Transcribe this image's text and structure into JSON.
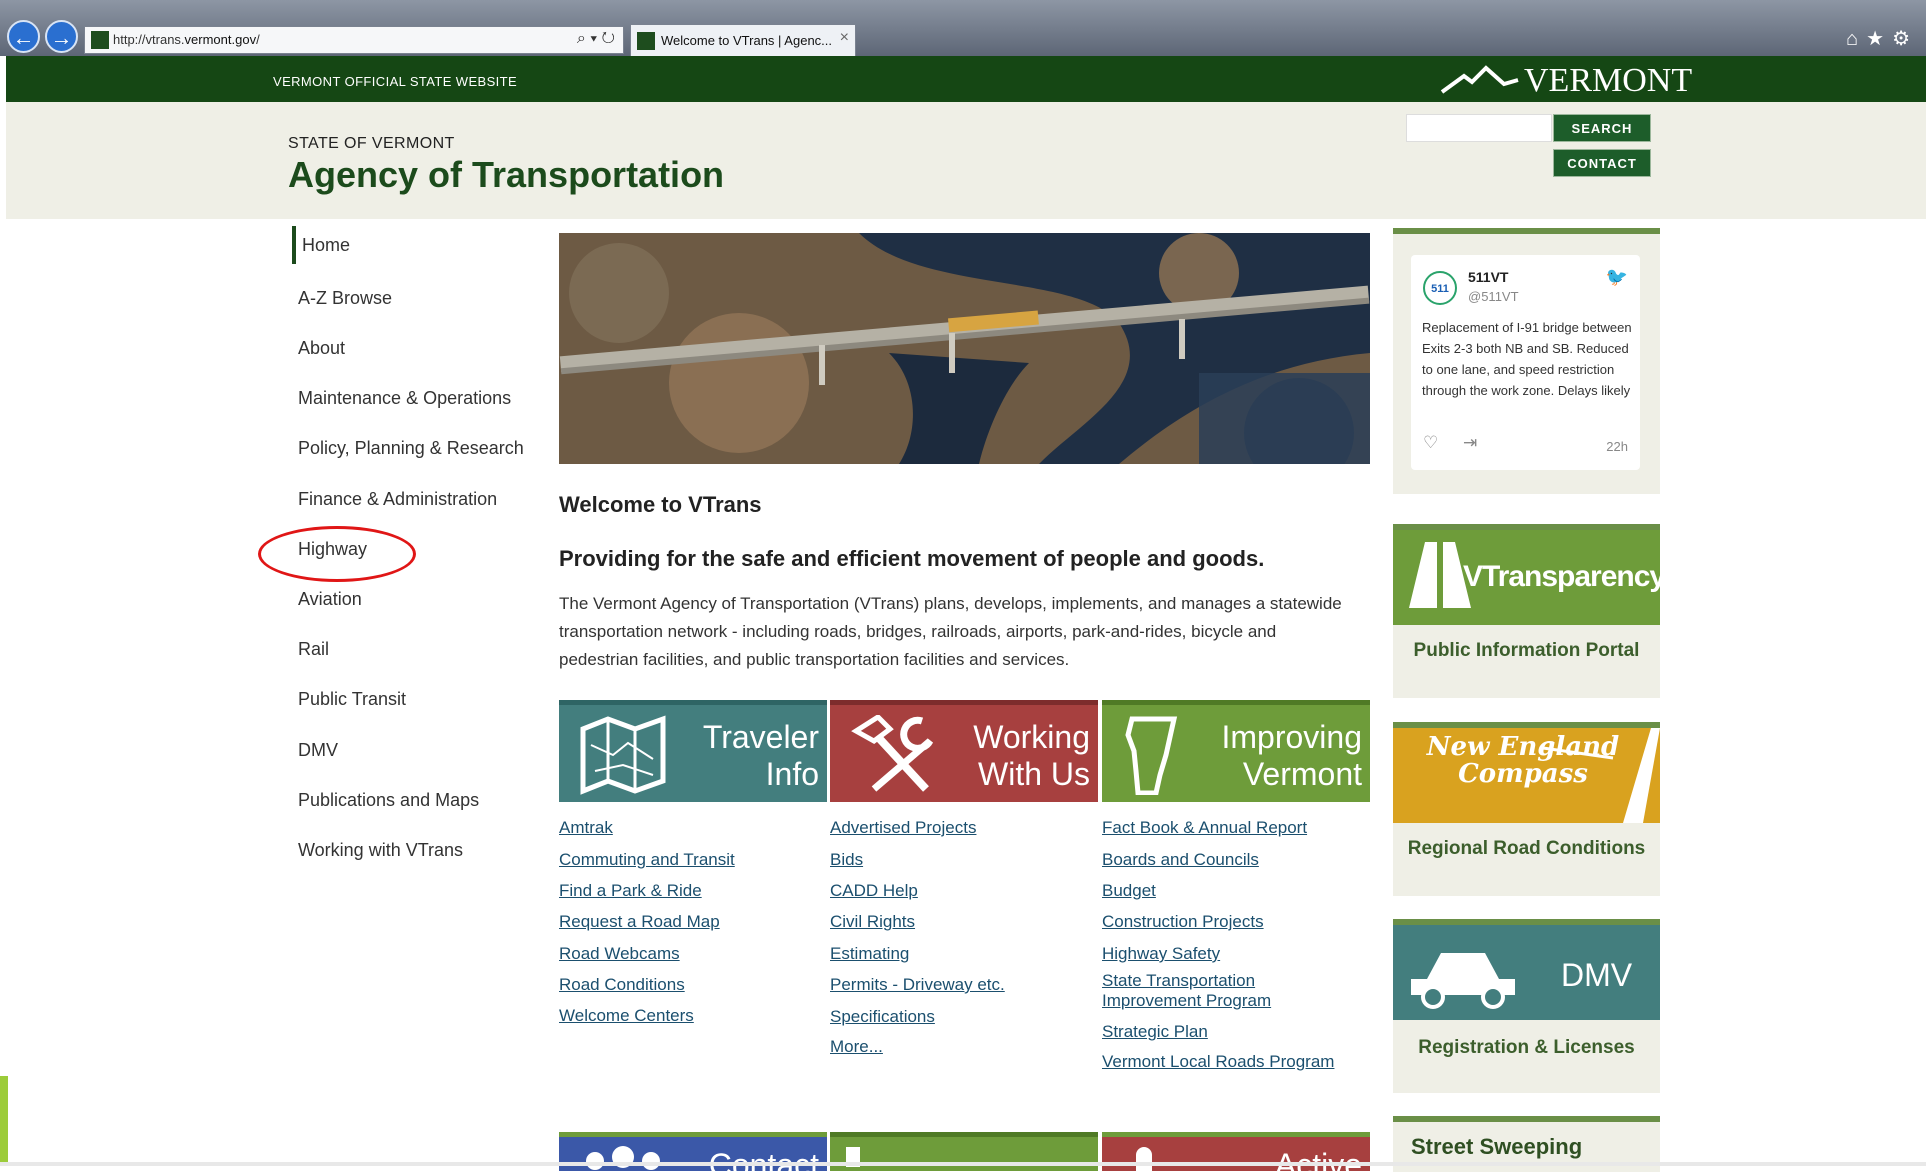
{
  "browser": {
    "url_prefix": "http://vtrans.",
    "url_domain": "vermont.gov",
    "url_suffix": "/",
    "tab_title": "Welcome to VTrans | Agenc...",
    "tab_close": "×",
    "icons": [
      "back-icon",
      "forward-icon",
      "search-icon",
      "refresh-icon",
      "home-icon",
      "star-icon",
      "gear-icon"
    ]
  },
  "topbar": {
    "title": "VERMONT OFFICIAL STATE WEBSITE",
    "logo_text": "VERMONT"
  },
  "header": {
    "state_label": "STATE OF VERMONT",
    "agency_title": "Agency of Transportation",
    "search_label": "SEARCH",
    "contact_label": "CONTACT",
    "search_placeholder": ""
  },
  "sidenav": {
    "items": [
      {
        "label": "Home"
      },
      {
        "label": "A-Z Browse"
      },
      {
        "label": "About"
      },
      {
        "label": "Maintenance & Operations"
      },
      {
        "label": "Policy, Planning & Research"
      },
      {
        "label": "Finance & Administration"
      },
      {
        "label": "Highway"
      },
      {
        "label": "Aviation"
      },
      {
        "label": "Rail"
      },
      {
        "label": "Public Transit"
      },
      {
        "label": "DMV"
      },
      {
        "label": "Publications and Maps"
      },
      {
        "label": "Working with VTrans"
      }
    ]
  },
  "main": {
    "welcome": "Welcome to VTrans",
    "tagline": "Providing for the safe and efficient movement of people and goods.",
    "description": "The Vermont Agency of Transportation (VTrans) plans, develops, implements, and manages a statewide transportation network - including roads, bridges, railroads, airports, park-and-rides, bicycle and pedestrian facilities, and public transportation facilities and services.",
    "tiles": [
      {
        "label": "Traveler\nInfo",
        "color": "#437e7e"
      },
      {
        "label": "Working\nWith Us",
        "color": "#a7403f"
      },
      {
        "label": "Improving\nVermont",
        "color": "#6e9c3a"
      }
    ],
    "columns": [
      {
        "links": [
          "Amtrak",
          "Commuting and Transit",
          "Find a Park & Ride",
          "Request a Road Map",
          "Road Webcams",
          "Road Conditions",
          "Welcome Centers"
        ]
      },
      {
        "links": [
          "Advertised Projects",
          "Bids",
          "CADD Help",
          "Civil Rights",
          "Estimating",
          "Permits - Driveway etc.",
          "Specifications",
          "More..."
        ]
      },
      {
        "links": [
          "Fact Book & Annual Report",
          "Boards and Councils",
          "Budget",
          "Construction Projects",
          "Highway Safety",
          "State Transportation",
          "Improvement Program",
          "Strategic Plan",
          "Vermont Local Roads Program"
        ]
      }
    ],
    "bottom_tiles": [
      {
        "label": "Contact",
        "color": "#3b58a8"
      },
      {
        "label": "",
        "color": "#6e9c3a"
      },
      {
        "label": "Active",
        "color": "#a7403f"
      }
    ]
  },
  "tweet": {
    "avatar_text": "511",
    "name": "511VT",
    "handle": "@511VT",
    "text": "Replacement of I-91 bridge between Exits 2-3 both NB and SB. Reduced to one lane, and speed restriction through the work zone. Delays likely",
    "time": "22h"
  },
  "right_cards": [
    {
      "title": "VTransparency",
      "caption": "Public Information Portal",
      "color": "#6e9c3a"
    },
    {
      "title": "New England Compass",
      "caption": "Regional Road Conditions",
      "color": "#d9a21f"
    },
    {
      "title": "DMV",
      "caption": "Registration & Licenses",
      "color": "#437e7e"
    },
    {
      "title": "",
      "caption": "Street Sweeping",
      "color": "#6e9c3a"
    }
  ]
}
